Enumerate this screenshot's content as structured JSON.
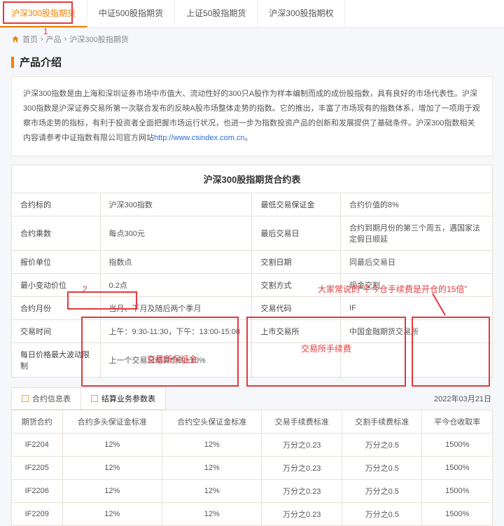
{
  "top_tabs": [
    "沪深300股指期货",
    "中证500股指期货",
    "上证50股指期货",
    "沪深300股指期权"
  ],
  "top_active": 0,
  "breadcrumb": [
    "首页",
    "产品",
    "沪深300股指期货"
  ],
  "section_title": "产品介绍",
  "intro_text": "沪深300指数是由上海和深圳证券市场中市值大、流动性好的300只A股作为样本编制而成的成份股指数，具有良好的市场代表性。沪深300指数是沪深证券交易所第一次联合发布的反映A股市场整体走势的指数。它的推出，丰富了市场现有的指数体系，增加了一项用于观察市场走势的指标，有利于投资者全面把握市场运行状况，也进一步为指数投资产品的创新和发展提供了基础条件。沪深300指数相关内容请参考中证指数有限公司官方网站",
  "intro_link": "http://www.csindex.com.cn",
  "intro_tail": "。",
  "spec_caption": "沪深300股指期货合约表",
  "spec_rows": [
    {
      "l1": "合约标的",
      "v1": "沪深300指数",
      "l2": "最低交易保证金",
      "v2": "合约价值的8%"
    },
    {
      "l1": "合约乘数",
      "v1": "每点300元",
      "l2": "最后交易日",
      "v2": "合约到期月份的第三个周五，遇国家法定假日顺延"
    },
    {
      "l1": "报价单位",
      "v1": "指数点",
      "l2": "交割日期",
      "v2": "同最后交易日"
    },
    {
      "l1": "最小变动价位",
      "v1": "0.2点",
      "l2": "交割方式",
      "v2": "现金交割"
    },
    {
      "l1": "合约月份",
      "v1": "当月、下月及随后两个季月",
      "l2": "交易代码",
      "v2": "IF"
    },
    {
      "l1": "交易时间",
      "v1": "上午：9:30-11:30，下午：13:00-15:00",
      "l2": "上市交易所",
      "v2": "中国金融期货交易所"
    },
    {
      "l1": "每日价格最大波动限制",
      "v1": "上一个交易日结算价的±10%",
      "l2": "",
      "v2": ""
    }
  ],
  "sub_tabs": [
    "合约信息表",
    "结算业务参数表"
  ],
  "sub_active": 1,
  "date_label": "2022年03月21日",
  "data_headers": [
    "期货合约",
    "合约多头保证金标准",
    "合约空头保证金标准",
    "交易手续费标准",
    "交割手续费标准",
    "平今仓收取率"
  ],
  "data_rows": [
    {
      "c": "IF2204",
      "v": [
        "12%",
        "12%",
        "万分之0.23",
        "万分之0.5",
        "1500%"
      ]
    },
    {
      "c": "IF2205",
      "v": [
        "12%",
        "12%",
        "万分之0.23",
        "万分之0.5",
        "1500%"
      ]
    },
    {
      "c": "IF2206",
      "v": [
        "12%",
        "12%",
        "万分之0.23",
        "万分之0.5",
        "1500%"
      ]
    },
    {
      "c": "IF2209",
      "v": [
        "12%",
        "12%",
        "万分之0.23",
        "万分之0.5",
        "1500%"
      ]
    }
  ],
  "annot": {
    "num1": "1",
    "num2": "2",
    "margin": "交易所保证金",
    "fee": "交易所手续费",
    "quote": "大家常说的“平今仓手续费是开仓的15倍”"
  }
}
